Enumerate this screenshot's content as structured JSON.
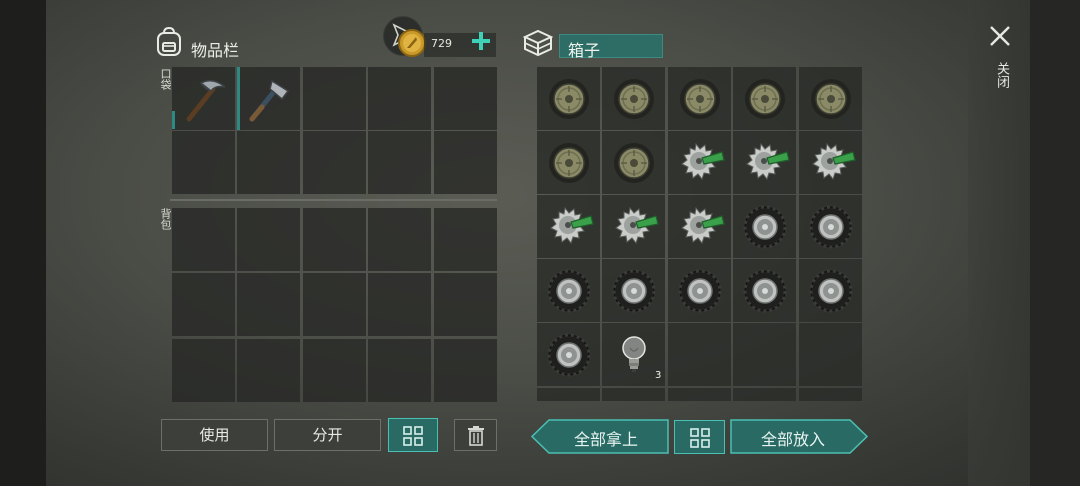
{
  "inventory": {
    "title": "物品栏",
    "pocket_label": "口袋",
    "backpack_label": "背包",
    "pocket_items": [
      {
        "slot": 0,
        "icon": "pickaxe-icon"
      },
      {
        "slot": 1,
        "icon": "hatchet-icon"
      }
    ]
  },
  "currency": {
    "icon": "coin-icon",
    "amount": "729",
    "add_icon": "plus-icon"
  },
  "container": {
    "title": "箱子",
    "icon": "crate-icon",
    "items": [
      "tire-rim-icon",
      "tire-rim-icon",
      "tire-rim-icon",
      "tire-rim-icon",
      "tire-rim-icon",
      "tire-rim-icon",
      "tire-rim-icon",
      "saw-blade-icon",
      "saw-blade-icon",
      "saw-blade-icon",
      "saw-blade-icon",
      "saw-blade-icon",
      "saw-blade-icon",
      "wheel-icon",
      "wheel-icon",
      "wheel-icon",
      "wheel-icon",
      "wheel-icon",
      "wheel-icon",
      "wheel-icon",
      "wheel-icon",
      "light-bulb-icon",
      "",
      "",
      ""
    ],
    "bulb_quantity": "3"
  },
  "buttons": {
    "use": "使用",
    "split": "分开",
    "sort_icon": "sort-grid-icon",
    "delete_icon": "trash-icon",
    "take_all": "全部拿上",
    "put_all": "全部放入"
  },
  "close": {
    "label": "关闭",
    "icon": "close-icon"
  },
  "colors": {
    "accent_teal": "#2a6a64",
    "teal_border": "#4bc0b2",
    "slot_bg": "#262825"
  }
}
